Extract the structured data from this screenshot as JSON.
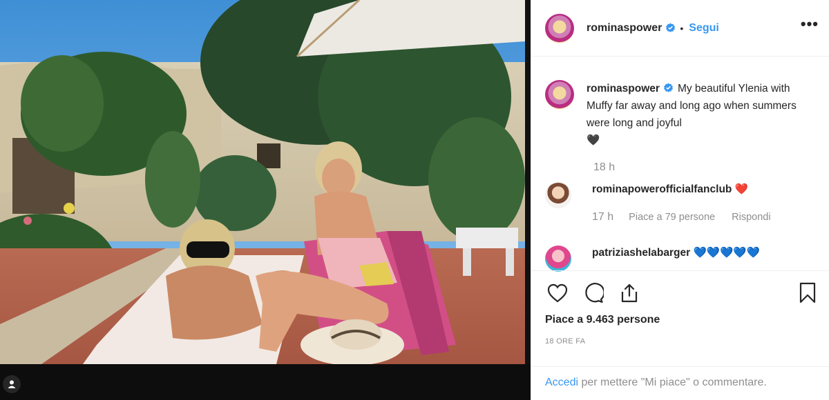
{
  "post": {
    "username": "rominaspower",
    "follow_label": "Segui",
    "separator": "•",
    "more_label": "•••",
    "caption_text": "My beautiful Ylenia with Muffy far away and long ago when summers were long and joyful",
    "caption_emoji": "🖤",
    "caption_time": "18 h"
  },
  "comments": [
    {
      "username": "rominapowerofficialfanclub",
      "text": "❤️",
      "time": "17 h",
      "likes_label": "Piace a 79 persone",
      "reply_label": "Rispondi"
    },
    {
      "username": "patriziashelabarger",
      "text": "💙💙💙💙💙"
    }
  ],
  "actions": {
    "likes_text": "Piace a 9.463 persone",
    "time_ago": "18 ORE FA",
    "login_link": "Accedi",
    "login_rest": " per mettere \"Mi piace\" o commentare."
  },
  "colors": {
    "link": "#3897f0",
    "muted": "#8e8e8e",
    "verified": "#3897f0"
  },
  "icons": [
    "verified-badge-icon",
    "heart-icon",
    "comment-icon",
    "share-icon",
    "bookmark-icon",
    "user-tag-icon"
  ]
}
